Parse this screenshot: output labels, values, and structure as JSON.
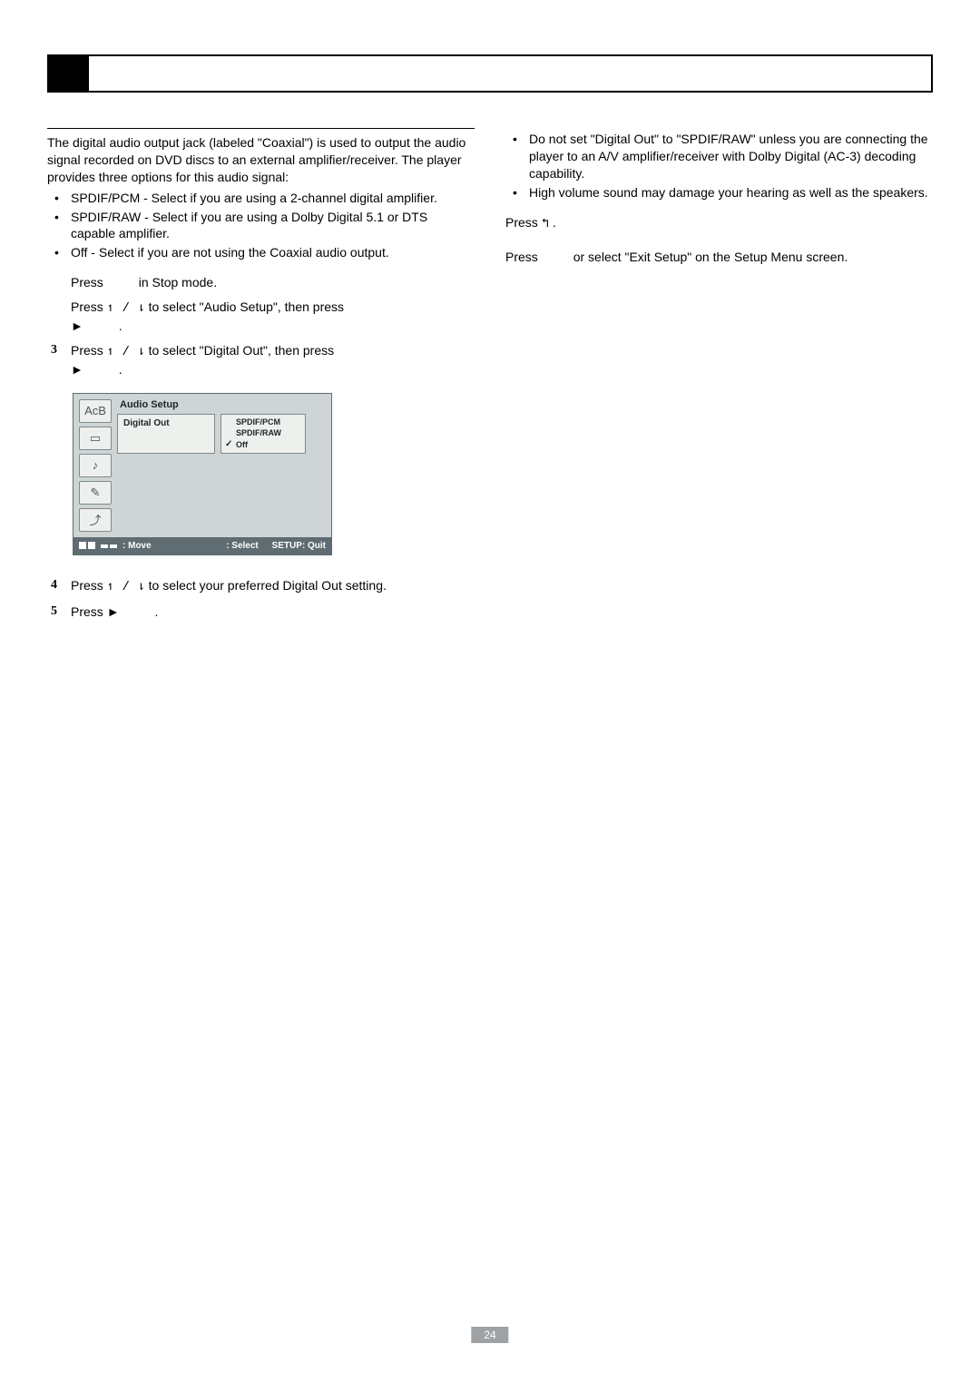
{
  "header": {
    "blank": ""
  },
  "left": {
    "intro": "The digital audio output jack (labeled \"Coaxial\") is used to output the audio signal recorded on DVD discs to an external amplifier/receiver. The player provides three options for this audio signal:",
    "options": [
      "SPDIF/PCM - Select if you are using a 2-channel digital amplifier.",
      "SPDIF/RAW - Select if you are using a Dolby Digital 5.1 or DTS capable amplifier.",
      "Off - Select if you are not using the Coaxial audio output."
    ],
    "steps": {
      "s1": {
        "a": "Press ",
        "b": " in Stop mode."
      },
      "s2": {
        "a": "Press ",
        "arr": "↿ / ⇂",
        "b": " to select \"Audio Setup\", then press ",
        "play": "►",
        "c": "."
      },
      "s3": {
        "num": "3",
        "a": "Press ",
        "arr": "↿ / ⇂",
        "b": " to select \"Digital Out\", then press ",
        "play": "►",
        "c": "."
      },
      "s4": {
        "num": "4",
        "a": "Press ",
        "arr": "↿ / ⇂",
        "b": " to select your preferred Digital Out setting."
      },
      "s5": {
        "num": "5",
        "a": "Press ",
        "play": "►",
        "b": "."
      }
    },
    "menu": {
      "title": "Audio Setup",
      "setting": "Digital Out",
      "options": [
        "SPDIF/PCM",
        "SPDIF/RAW",
        "Off"
      ],
      "checked_index": 2,
      "icons": [
        "AcB",
        "▭",
        "♪",
        "✎",
        "⤴"
      ],
      "footer": {
        "move": ": Move",
        "select": ": Select",
        "quit": "SETUP: Quit"
      }
    }
  },
  "right": {
    "notes": [
      "Do not set \"Digital Out\" to \"SPDIF/RAW\" unless you are connecting the player to an A/V amplifier/receiver with Dolby Digital (AC-3) decoding capability.",
      "High volume sound may damage your hearing as well as the speakers."
    ],
    "return": {
      "a": "Press ",
      "glyph": "↰",
      "b": "."
    },
    "exit": {
      "a": "Press ",
      "b": " or select \"Exit Setup\" on the Setup Menu screen."
    }
  },
  "page_number": "24"
}
